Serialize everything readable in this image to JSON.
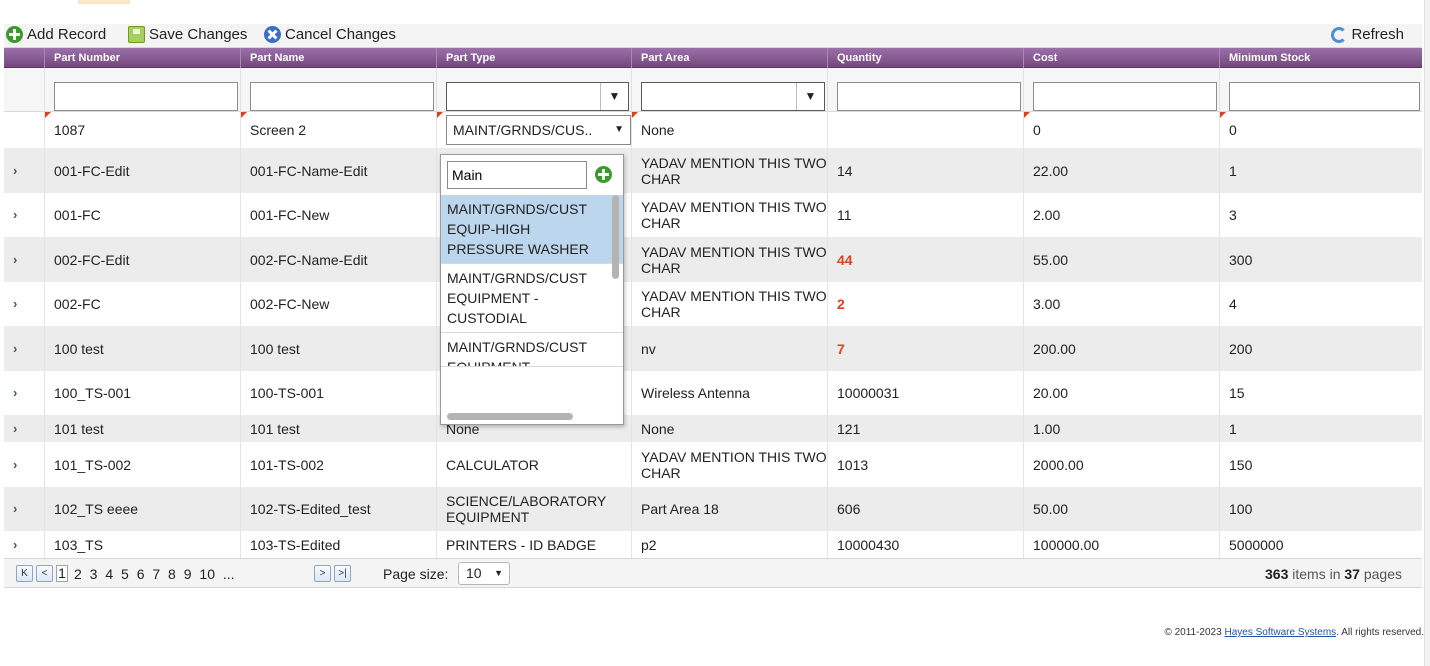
{
  "toolbar": {
    "add": "Add Record",
    "save": "Save Changes",
    "cancel": "Cancel Changes",
    "refresh": "Refresh"
  },
  "columns": [
    "",
    "Part Number",
    "Part Name",
    "Part Type",
    "Part Area",
    "Quantity",
    "Cost",
    "Minimum Stock"
  ],
  "new_row": {
    "part_number": "1087",
    "part_name": "Screen 2",
    "part_type": "MAINT/GRNDS/CUS..",
    "part_area": "None",
    "quantity": "",
    "cost": "0",
    "min_stock": "0"
  },
  "rows": [
    {
      "expander": "›",
      "part_number": "001-FC-Edit",
      "part_name": "001-FC-Name-Edit",
      "part_type": "",
      "part_area": "YADAV MENTION THIS TWO CHAR",
      "quantity": "14",
      "cost": "22.00",
      "min_stock": "1"
    },
    {
      "expander": "›",
      "part_number": "001-FC",
      "part_name": "001-FC-New",
      "part_type": "",
      "part_area": "YADAV MENTION THIS TWO CHAR",
      "quantity": "11",
      "cost": "2.00",
      "min_stock": "3"
    },
    {
      "expander": "›",
      "part_number": "002-FC-Edit",
      "part_name": "002-FC-Name-Edit",
      "part_type": "",
      "part_area": "YADAV MENTION THIS TWO CHAR",
      "quantity": "44",
      "cost": "55.00",
      "min_stock": "300"
    },
    {
      "expander": "›",
      "part_number": "002-FC",
      "part_name": "002-FC-New",
      "part_type": "",
      "part_area": "YADAV MENTION THIS TWO CHAR",
      "quantity": "2",
      "cost": "3.00",
      "min_stock": "4"
    },
    {
      "expander": "›",
      "part_number": "100 test",
      "part_name": "100 test",
      "part_type": "",
      "part_area": "nv",
      "quantity": "7",
      "cost": "200.00",
      "min_stock": "200"
    },
    {
      "expander": "›",
      "part_number": "100_TS-001",
      "part_name": "100-TS-001",
      "part_type": "",
      "part_area": "Wireless Antenna",
      "quantity": "10000031",
      "cost": "20.00",
      "min_stock": "15"
    },
    {
      "expander": "›",
      "part_number": "101 test",
      "part_name": "101 test",
      "part_type": "None",
      "part_area": "None",
      "quantity": "121",
      "cost": "1.00",
      "min_stock": "1"
    },
    {
      "expander": "›",
      "part_number": "101_TS-002",
      "part_name": "101-TS-002",
      "part_type": "CALCULATOR",
      "part_area": "YADAV MENTION THIS TWO CHAR",
      "quantity": "1013",
      "cost": "2000.00",
      "min_stock": "150"
    },
    {
      "expander": "›",
      "part_number": "102_TS eeee",
      "part_name": "102-TS-Edited_test",
      "part_type": "SCIENCE/LABORATORY EQUIPMENT",
      "part_area": "Part Area 18",
      "quantity": "606",
      "cost": "50.00",
      "min_stock": "100"
    },
    {
      "expander": "›",
      "part_number": "103_TS",
      "part_name": "103-TS-Edited",
      "part_type": "PRINTERS - ID BADGE",
      "part_area": "p2",
      "quantity": "10000430",
      "cost": "100000.00",
      "min_stock": "5000000"
    }
  ],
  "dropdown": {
    "search_value": "Main",
    "items": [
      "MAINT/GRNDS/CUST EQUIP-HIGH PRESSURE WASHER",
      "MAINT/GRNDS/CUST EQUIPMENT - CUSTODIAL",
      "MAINT/GRNDS/CUST EQUIPMENT -"
    ]
  },
  "pager": {
    "first": "K",
    "prev": "<",
    "current": "1",
    "pages": "2 3 4 5 6 7 8 9 10 ...",
    "next": ">",
    "last": ">|",
    "size_label": "Page size:",
    "size_value": "10",
    "items_count": "363",
    "items_word": "items in",
    "pages_count": "37",
    "pages_word": "pages"
  },
  "footer": {
    "prefix": "© 2011-2023 ",
    "company": "Hayes Software Systems",
    "suffix": ". All rights reserved."
  },
  "colors": {
    "header_purple": "#7e4f88",
    "dirty_marker": "#e0401f",
    "selected_item": "#bcd6ed"
  }
}
